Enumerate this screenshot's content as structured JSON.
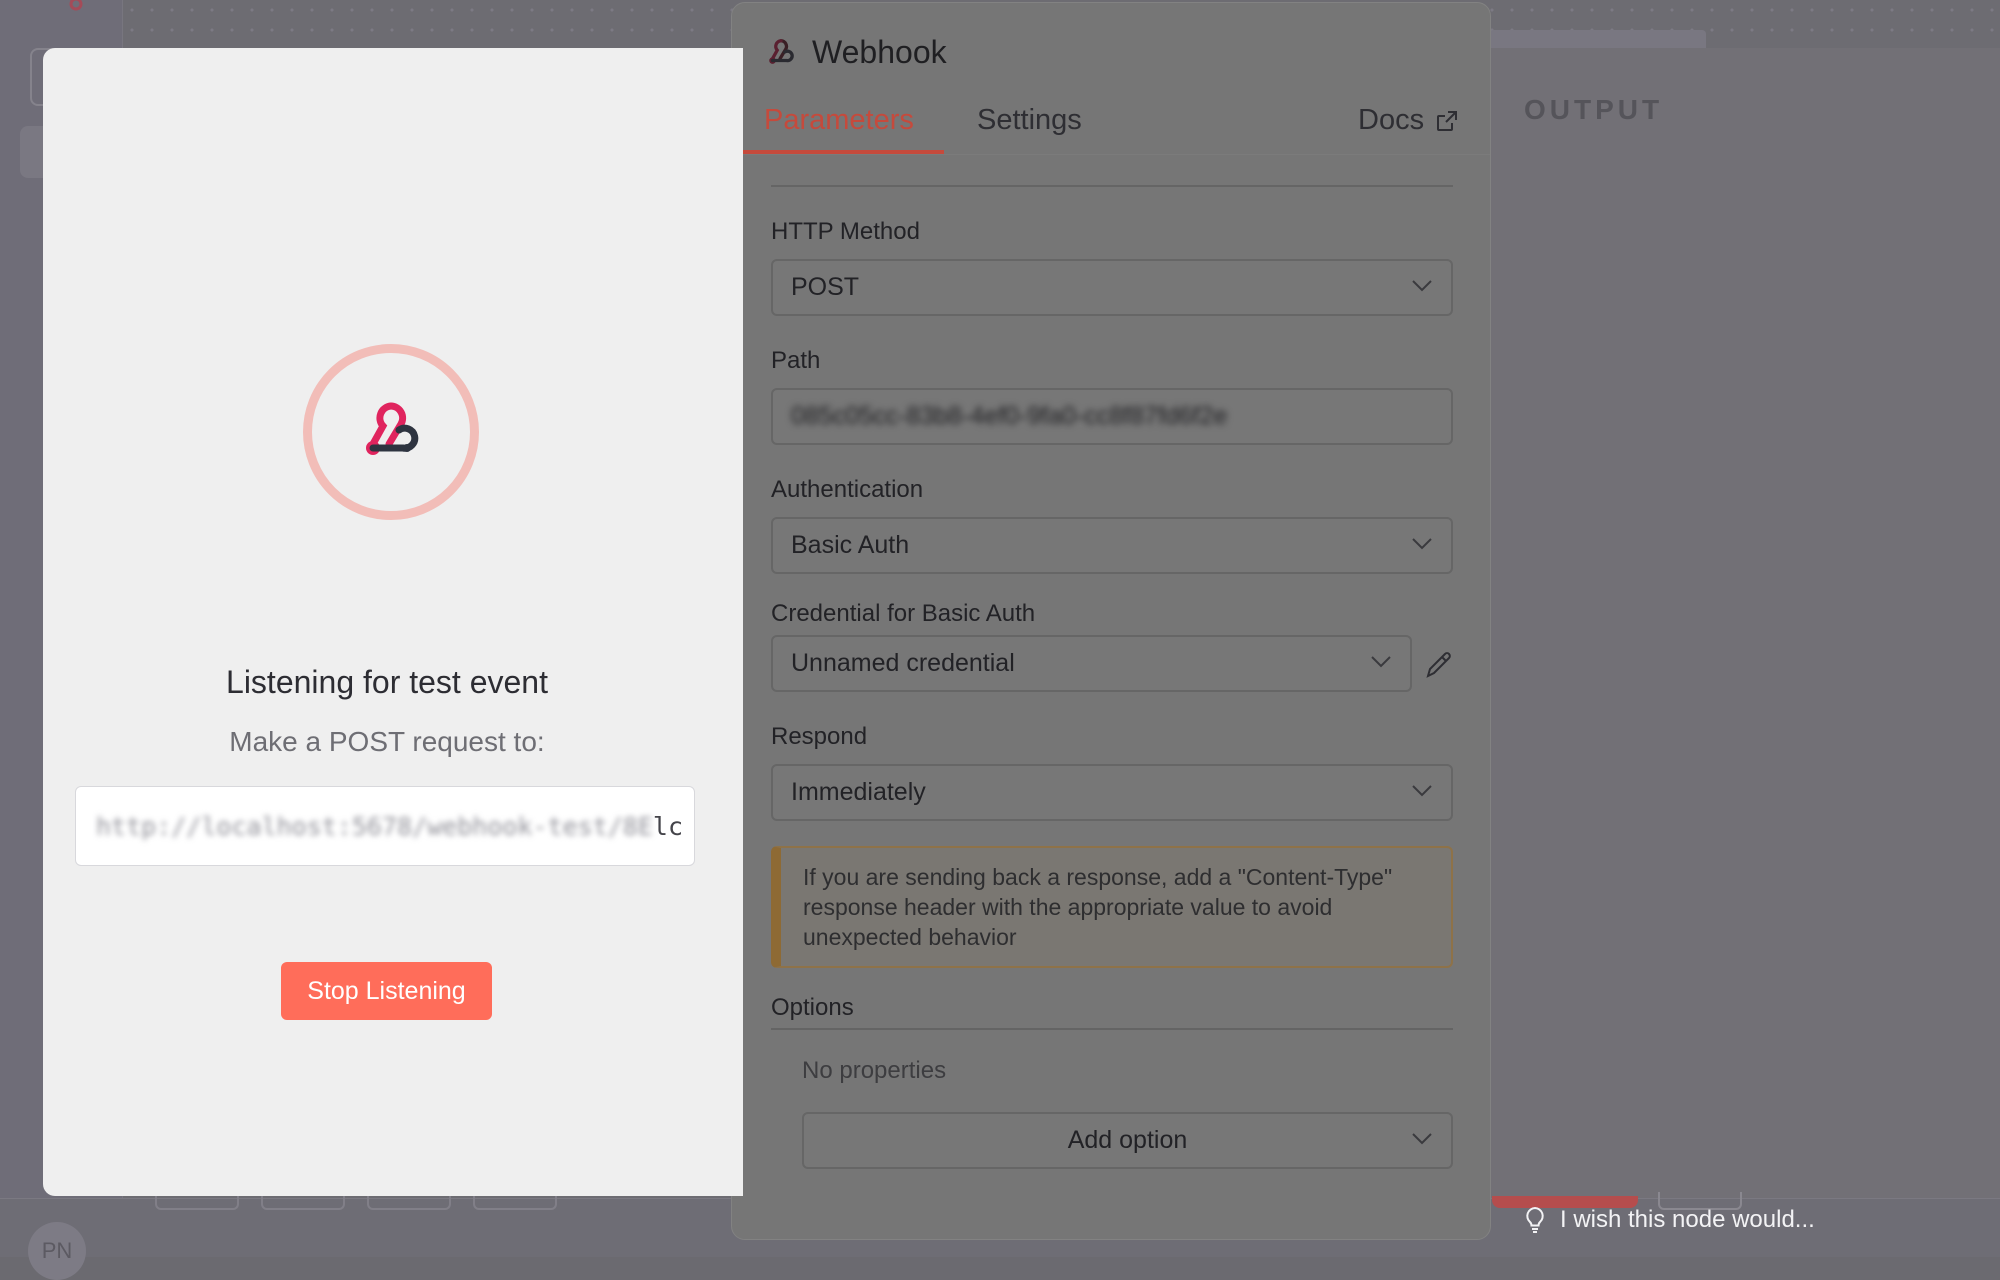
{
  "listening": {
    "title": "Listening for test event",
    "subtitle": "Make a POST request to:",
    "url_obscured": "http://localhost:5678/webhook-test/8E",
    "url_visible_tail": "lc",
    "stop_button": "Stop Listening"
  },
  "node": {
    "title": "Webhook",
    "tabs": {
      "parameters": "Parameters",
      "settings": "Settings",
      "docs": "Docs"
    },
    "fields": {
      "http_method": {
        "label": "HTTP Method",
        "value": "POST"
      },
      "path": {
        "label": "Path",
        "value": "085c05cc-83b8-4ef0-9fa0-cc8f87fd6f2e"
      },
      "authentication": {
        "label": "Authentication",
        "value": "Basic Auth"
      },
      "credential": {
        "label": "Credential for Basic Auth",
        "value": "Unnamed credential"
      },
      "respond": {
        "label": "Respond",
        "value": "Immediately"
      }
    },
    "notice": "If you are sending back a response, add a \"Content-Type\" response header with the appropriate value to avoid unexpected behavior",
    "options": {
      "header": "Options",
      "empty": "No properties",
      "add_button": "Add option"
    }
  },
  "output": {
    "label": "OUTPUT",
    "feedback": "I wish this node would..."
  },
  "background": {
    "avatar_initials": "PN"
  },
  "colors": {
    "accent": "#ff6d5a",
    "tab_active": "#c54a3c",
    "ring": "#f2bdb8",
    "webhook_pink": "#e0245e"
  }
}
